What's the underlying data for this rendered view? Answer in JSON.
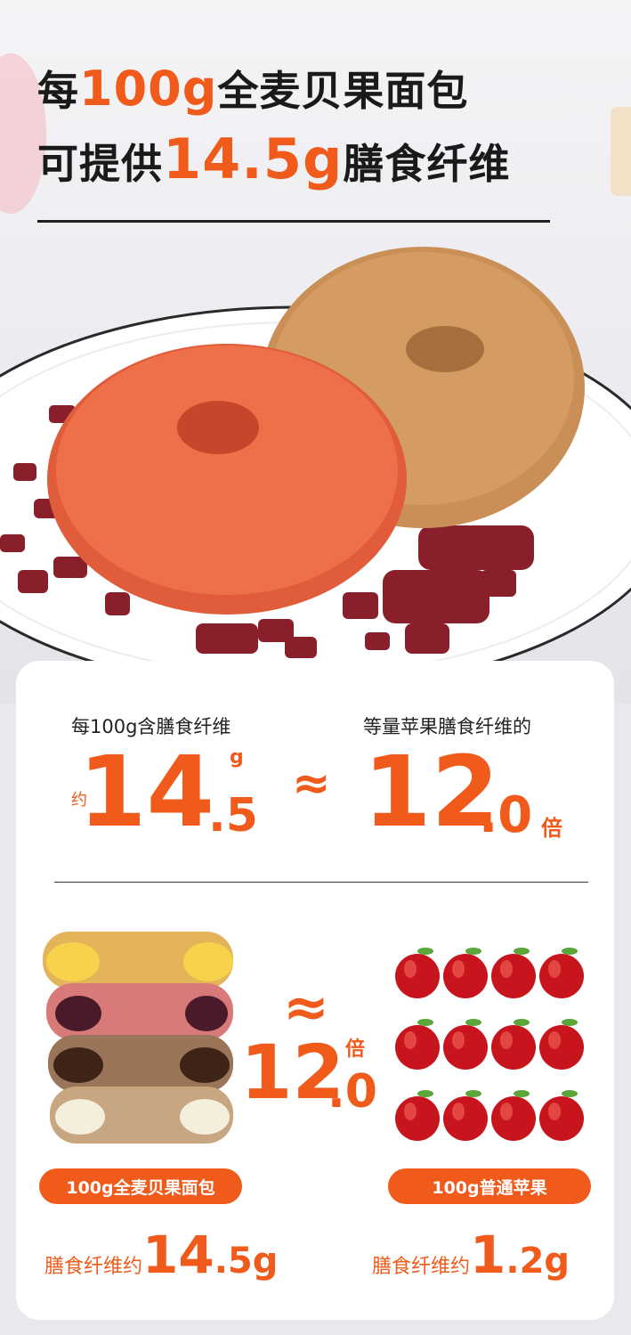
{
  "hero": {
    "line1_pre": "每",
    "line1_num": "100g",
    "line1_post": "全麦贝果面包",
    "line2_pre": "可提供",
    "line2_num": "14.5g",
    "line2_post": "膳食纤维"
  },
  "comparison": {
    "left_label": "每100g含膳食纤维",
    "left_prefix": "约",
    "left_int": "14",
    "left_dec": ".5",
    "left_unit": "g",
    "approx": "≈",
    "right_label": "等量苹果膳食纤维的",
    "right_int": "12",
    "right_dec": ".0",
    "right_unit": "倍"
  },
  "visual": {
    "approx": "≈",
    "ratio_int": "12",
    "ratio_dec": ".0",
    "ratio_unit": "倍",
    "bagel_pill": "100g全麦贝果面包",
    "apple_pill": "100g普通苹果",
    "bagel_stat_label": "膳食纤维约",
    "bagel_stat_int": "14",
    "bagel_stat_dec": ".5g",
    "apple_stat_label": "膳食纤维约",
    "apple_stat_int": "1",
    "apple_stat_dec": ".2g",
    "apple_count": 12
  },
  "colors": {
    "accent": "#f05a1a",
    "text": "#1a1a1a",
    "card": "#ffffff"
  }
}
